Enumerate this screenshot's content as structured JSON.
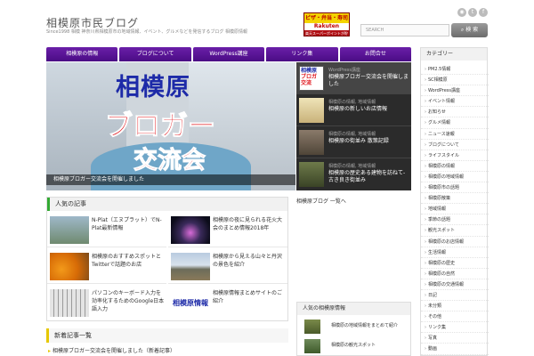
{
  "header": {
    "site_title": "相模原市民ブログ",
    "site_description": "Since1998 相模 神奈川県相模原市の地域情報、イベント、グルメなどを発信するブログ 相模原情報",
    "ad": {
      "top": "ピザ・弁当・寿司",
      "middle": "Rakuten",
      "bottom": "楽天スーパーポイントが貯まる"
    },
    "social": [
      "rss-icon",
      "twitter-icon",
      "facebook-icon"
    ],
    "search": {
      "placeholder": "SEARCH",
      "button_label": "検 索"
    }
  },
  "nav": {
    "items": [
      "相模原の情報",
      "ブログについて",
      "WordPress講座",
      "リンク集",
      "お問合せ"
    ]
  },
  "featured": {
    "line1": "相模原",
    "line2": "ブロガー",
    "line3": "交流会",
    "caption": "相模原ブロガー交流会を開催しました",
    "side_entries": [
      {
        "meta": "WordPress講座",
        "title": "相模原ブロガー交流会を開催しました"
      },
      {
        "meta": "相模原の情報, 地域情報",
        "title": "相模原の新しいお店情報"
      },
      {
        "meta": "相模原の情報, 地域情報",
        "title": "相模原の街並み 散策記録"
      },
      {
        "meta": "相模原の情報, 地域情報",
        "title": "相模原の歴史ある建物を訪ねて-古き良き街並み"
      }
    ]
  },
  "popular": {
    "heading": "人気の記事",
    "items": [
      {
        "title": "N-Plat（エヌプラット）でN-Plat最新情報"
      },
      {
        "title": "相模原の夜に見られる花火大会のまとめ情報2018年"
      },
      {
        "title": "相模原のおすすめスポットとTwitterで話題のお店"
      },
      {
        "title": "相模原から見える山々と丹沢の景色を紹介"
      },
      {
        "title": "パソコンのキーボード入力を効率化するためのGoogle日本語入力"
      },
      {
        "title": "相模原情報まとめサイトのご紹介"
      }
    ],
    "thumb_labels": {
      "sagamihara_info": "相模原情報"
    }
  },
  "new_posts": {
    "heading": "新着記事一覧",
    "first_item": "相模原ブロガー交流会を開催しました（新着記事）"
  },
  "middle": {
    "link_text": "相模原ブログ 一覧へ",
    "box_heading": "人気の相模原情報",
    "rows": [
      "相模原の地域情報をまとめて紹介",
      "相模原の観光スポット"
    ]
  },
  "sidebar": {
    "heading": "カテゴリー",
    "categories": [
      "PM2.5情報",
      "SC相模原",
      "WordPress講座",
      "イベント情報",
      "お知らせ",
      "グルメ情報",
      "ニュース速報",
      "ブログについて",
      "ライフスタイル",
      "相模原の情報",
      "相模原の地域情報",
      "相模原市の話題",
      "相模原散策",
      "地域情報",
      "季節の話題",
      "観光スポット",
      "相模原のお店情報",
      "生活情報",
      "相模原の歴史",
      "相模原の自然",
      "相模原の交通情報",
      "日記",
      "未分類",
      "その他",
      "リンク集",
      "写真",
      "動画"
    ]
  },
  "colors": {
    "nav_purple": "#5a1596",
    "accent_green": "#33aa33",
    "accent_yellow": "#e6c800"
  }
}
